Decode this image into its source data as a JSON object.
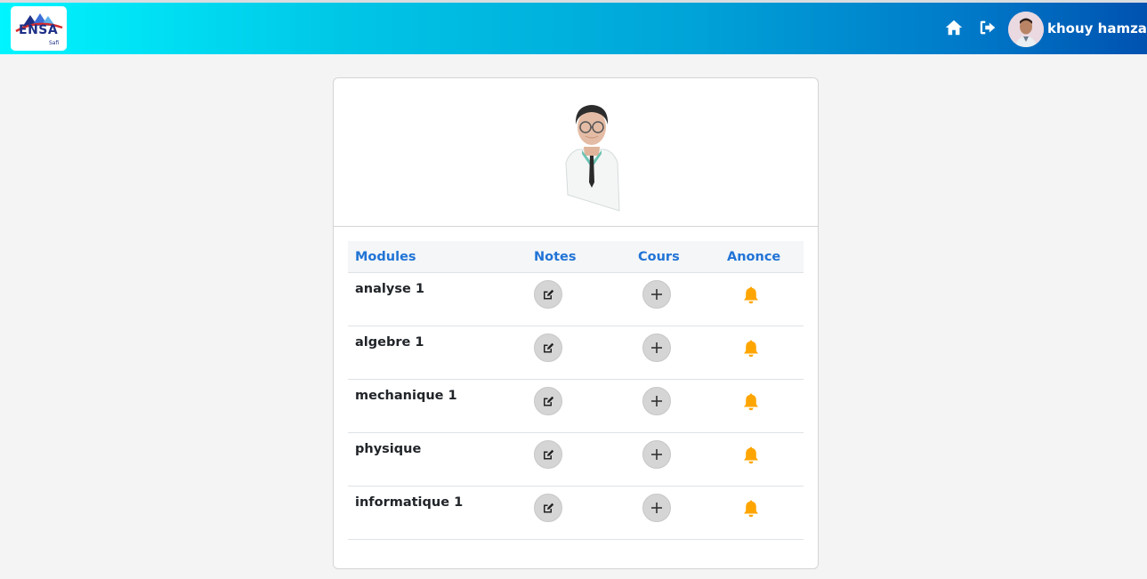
{
  "header": {
    "logo_text": "ENSA",
    "logo_sub": "Safi",
    "user_name": "khouy hamzae",
    "icons": [
      "home-icon",
      "logout-icon"
    ]
  },
  "table": {
    "headers": [
      "Modules",
      "Notes",
      "Cours",
      "Anonce"
    ],
    "rows": [
      {
        "module": "analyse 1"
      },
      {
        "module": "algebre 1"
      },
      {
        "module": "mechanique 1"
      },
      {
        "module": "physique"
      },
      {
        "module": "informatique 1"
      }
    ]
  },
  "colors": {
    "header_accent": "#2174d6",
    "bell": "#ffa500",
    "nav_gradient_start": "#00f5ff",
    "nav_gradient_end": "#0052b0"
  }
}
